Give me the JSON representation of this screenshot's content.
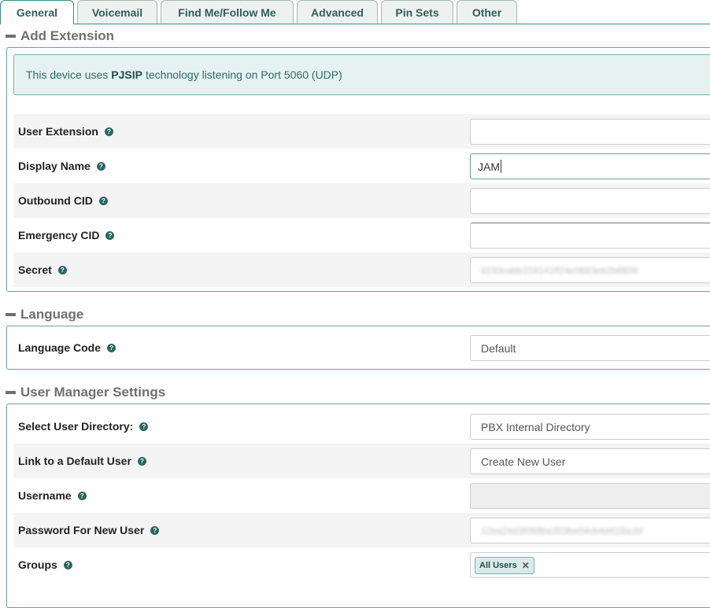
{
  "tabs": [
    {
      "label": "General",
      "active": true
    },
    {
      "label": "Voicemail"
    },
    {
      "label": "Find Me/Follow Me"
    },
    {
      "label": "Advanced"
    },
    {
      "label": "Pin Sets"
    },
    {
      "label": "Other"
    }
  ],
  "add_extension": {
    "title": "Add Extension",
    "alert": {
      "prefix": "This device uses",
      "tech": "PJSIP",
      "suffix": "technology listening on Port 5060 (UDP)"
    },
    "fields": {
      "user_extension": {
        "label": "User Extension",
        "value": ""
      },
      "display_name": {
        "label": "Display Name",
        "value": "JAM"
      },
      "outbound_cid": {
        "label": "Outbound CID",
        "value": ""
      },
      "emergency_cid": {
        "label": "Emergency CID",
        "value": ""
      },
      "secret": {
        "label": "Secret",
        "value": "8193cabb159141ff24e0683eb2b6606"
      }
    }
  },
  "language": {
    "title": "Language",
    "fields": {
      "language_code": {
        "label": "Language Code",
        "value": "Default"
      }
    }
  },
  "user_manager": {
    "title": "User Manager Settings",
    "fields": {
      "select_directory": {
        "label": "Select User Directory:",
        "value": "PBX Internal Directory"
      },
      "link_default_user": {
        "label": "Link to a Default User",
        "value": "Create New User"
      },
      "username": {
        "label": "Username",
        "value": ""
      },
      "password": {
        "label": "Password For New User",
        "value": "12ea24d3f068ba303be04cb4d418acbf"
      },
      "groups": {
        "label": "Groups",
        "chip": "All Users",
        "chip_remove": "✕"
      }
    }
  },
  "icons": {
    "help": "question-circle-icon",
    "collapse": "minus-icon"
  },
  "colors": {
    "accent": "#3f8d85",
    "alert_bg": "#e6f2f1",
    "row_shade": "#f4f4f4"
  }
}
